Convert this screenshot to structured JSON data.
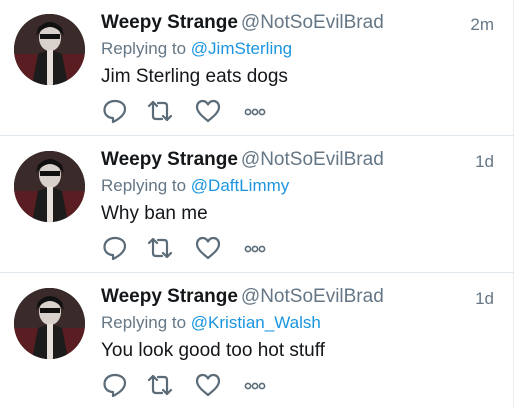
{
  "tweets": [
    {
      "name": "Weepy Strange",
      "handle": "@NotSoEvilBrad",
      "time": "2m",
      "replying_prefix": "Replying to",
      "replying_target": "@JimSterling",
      "text": "Jim Sterling eats dogs"
    },
    {
      "name": "Weepy Strange",
      "handle": "@NotSoEvilBrad",
      "time": "1d",
      "replying_prefix": "Replying to",
      "replying_target": "@DaftLimmy",
      "text": "Why ban me"
    },
    {
      "name": "Weepy Strange",
      "handle": "@NotSoEvilBrad",
      "time": "1d",
      "replying_prefix": "Replying to",
      "replying_target": "@Kristian_Walsh",
      "text": "You look good too hot stuff"
    }
  ],
  "actions": {
    "reply_icon": "reply-icon",
    "retweet_icon": "retweet-icon",
    "like_icon": "like-icon",
    "more_icon": "more-icon"
  },
  "colors": {
    "link": "#1b95e0",
    "secondary_text": "#657786",
    "primary_text": "#14171a",
    "icon": "#5b6c78",
    "divider": "#e1e8ed"
  }
}
